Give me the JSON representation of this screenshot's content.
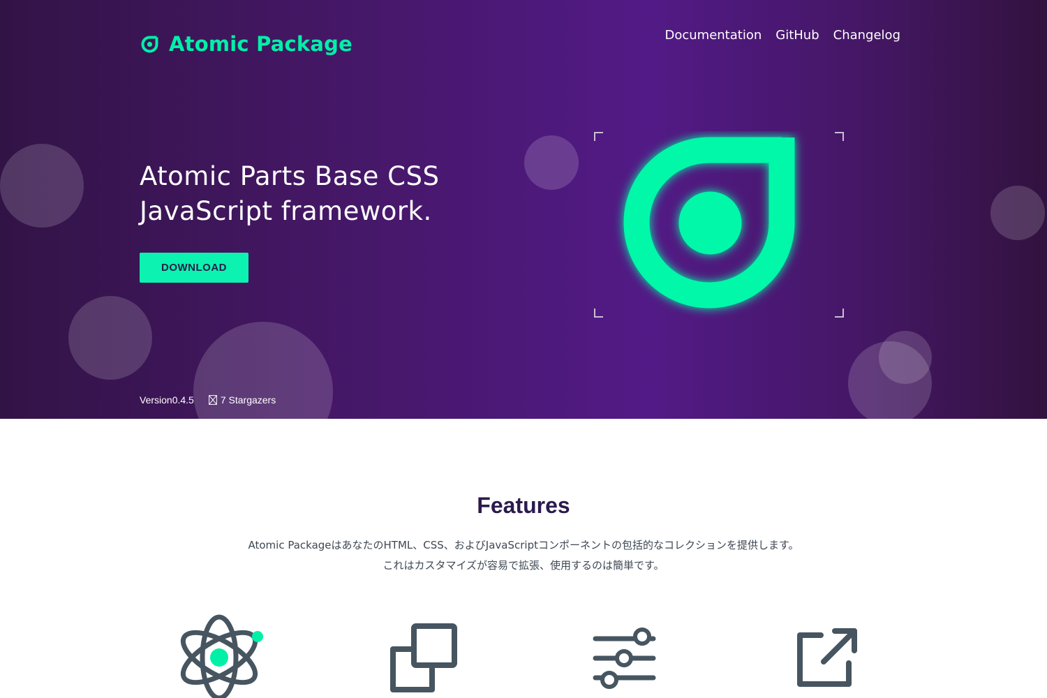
{
  "brand": {
    "name": "Atomic Package",
    "icon": "atomic-logo-icon",
    "accent": "#00f0a8"
  },
  "nav": {
    "documentation": "Documentation",
    "github": "GitHub",
    "changelog": "Changelog"
  },
  "hero": {
    "headline_line1": "Atomic Parts Base CSS",
    "headline_line2": "JavaScript framework.",
    "download_label": "DOWNLOAD",
    "version": "Version0.4.5",
    "stargazers": "7 Stargazers",
    "star_icon": "star-icon",
    "logo_icon": "atomic-logo-icon",
    "background": "#4a1778"
  },
  "features": {
    "title": "Features",
    "desc_line1": "Atomic PackageはあなたのHTML、CSS、およびJavaScriptコンポーネントの包括的なコレクションを提供します。",
    "desc_line2": "これはカスタマイズが容易で拡張、使用するのは簡単です。",
    "icons": [
      "atom-icon",
      "copy-icon",
      "sliders-icon",
      "external-link-icon"
    ],
    "icon_color": "#465560",
    "accent": "#00f0a8"
  }
}
